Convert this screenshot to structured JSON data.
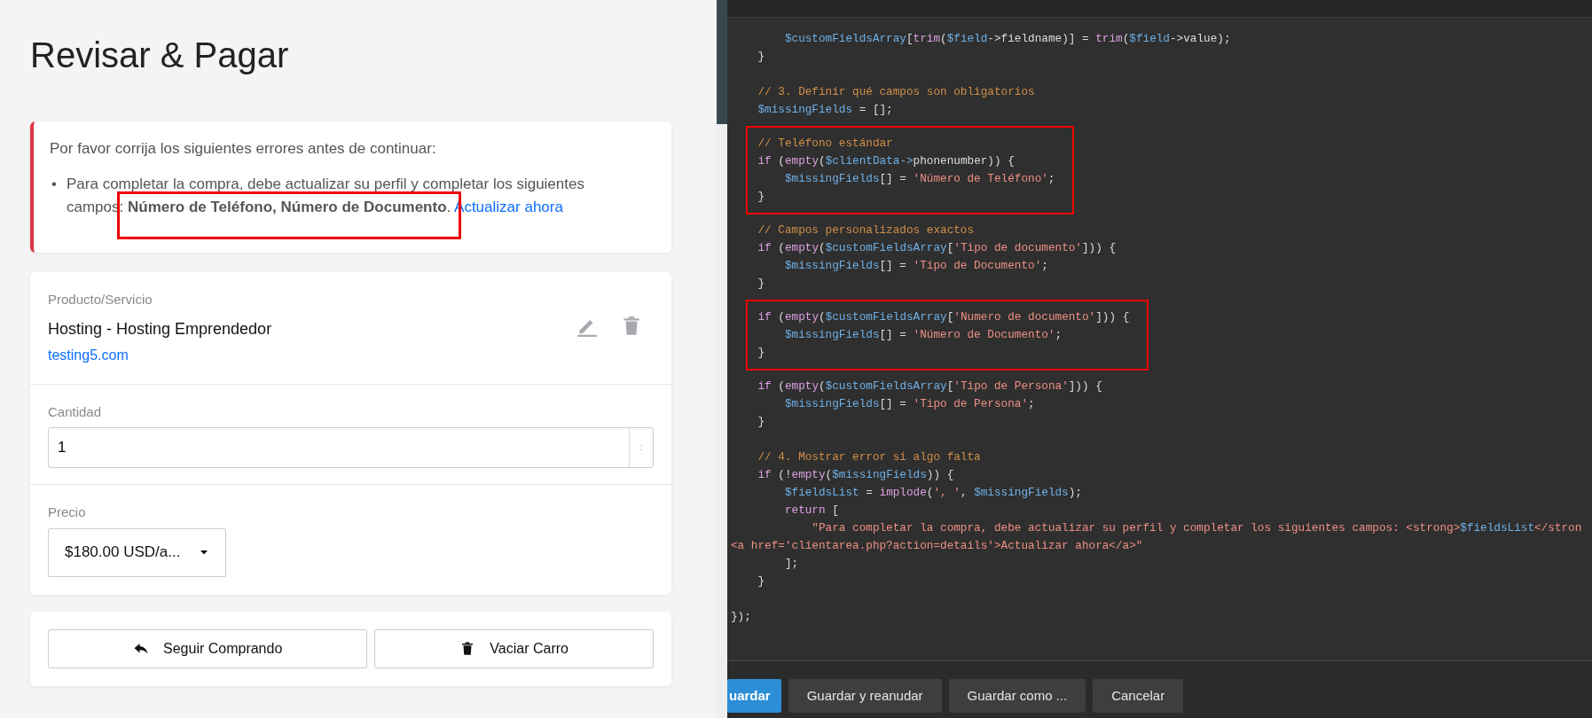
{
  "checkout": {
    "title": "Revisar & Pagar",
    "error_alert": {
      "intro": "Por favor corrija los siguientes errores antes de continuar:",
      "items": [
        {
          "bullet": "•",
          "text": "Para completar la compra, debe actualizar su perfil y completar los siguientes campos: **Número de Teléfono, Número de Documento**.",
          "link": "Actualizar ahora",
          "highlighted": true
        }
      ]
    },
    "product": {
      "label": "Producto/Servicio",
      "name": "Hosting - Hosting Emprendedor",
      "domain": "testing5.com"
    },
    "quantity": {
      "label": "Cantidad",
      "value": "1"
    },
    "price": {
      "label": "Precio",
      "value": "$180.00 USD/a..."
    },
    "actions": [
      {
        "label": "Seguir Comprando",
        "kind": "reply"
      },
      {
        "label": "Vaciar Carro",
        "kind": "trash"
      }
    ]
  },
  "editor": {
    "code_blocks": [
      {
        "highlighted": false,
        "lines": [
          {
            "kind": "code",
            "tokens": [
              {
                "kind": "var",
                "text": "        $customFieldsArray"
              },
              {
                "kind": "plain",
                "text": "["
              },
              {
                "kind": "func",
                "text": "trim"
              },
              {
                "kind": "plain",
                "text": "("
              },
              {
                "kind": "var",
                "text": "$field"
              },
              {
                "kind": "plain",
                "text": "->fieldname)] = "
              },
              {
                "kind": "func",
                "text": "trim"
              },
              {
                "kind": "plain",
                "text": "("
              },
              {
                "kind": "var",
                "text": "$field"
              },
              {
                "kind": "plain",
                "text": "->value);"
              }
            ]
          },
          {
            "kind": "code",
            "tokens": [
              {
                "kind": "plain",
                "text": "    }"
              }
            ]
          },
          {
            "kind": "blank"
          },
          {
            "kind": "code",
            "tokens": [
              {
                "kind": "comment",
                "text": "    // 3. Definir qué campos son obligatorios"
              }
            ]
          },
          {
            "kind": "code",
            "tokens": [
              {
                "kind": "var",
                "text": "    $missingFields"
              },
              {
                "kind": "plain",
                "text": " = [];"
              }
            ]
          }
        ]
      },
      {
        "highlighted": true,
        "lines": [
          {
            "kind": "code",
            "tokens": [
              {
                "kind": "comment",
                "text": "    // Teléfono estándar"
              }
            ]
          },
          {
            "kind": "code",
            "tokens": [
              {
                "kind": "func",
                "text": "    if"
              },
              {
                "kind": "plain",
                "text": " ("
              },
              {
                "kind": "func",
                "text": "empty"
              },
              {
                "kind": "plain",
                "text": "("
              },
              {
                "kind": "var",
                "text": "$clientData->"
              },
              {
                "kind": "plain",
                "text": "phonenumber)) {"
              }
            ]
          },
          {
            "kind": "code",
            "tokens": [
              {
                "kind": "var",
                "text": "        $missingFields"
              },
              {
                "kind": "plain",
                "text": "[] = "
              },
              {
                "kind": "string",
                "text": "'Número de Teléfono'"
              },
              {
                "kind": "plain",
                "text": ";"
              }
            ]
          },
          {
            "kind": "code",
            "tokens": [
              {
                "kind": "plain",
                "text": "    }"
              }
            ]
          }
        ]
      },
      {
        "highlighted": false,
        "lines": [
          {
            "kind": "code",
            "tokens": [
              {
                "kind": "comment",
                "text": "    // Campos personalizados exactos"
              }
            ]
          },
          {
            "kind": "code",
            "tokens": [
              {
                "kind": "func",
                "text": "    if"
              },
              {
                "kind": "plain",
                "text": " ("
              },
              {
                "kind": "func",
                "text": "empty"
              },
              {
                "kind": "plain",
                "text": "("
              },
              {
                "kind": "var",
                "text": "$customFieldsArray"
              },
              {
                "kind": "plain",
                "text": "["
              },
              {
                "kind": "string",
                "text": "'Tipo de documento'"
              },
              {
                "kind": "plain",
                "text": "])) {"
              }
            ]
          },
          {
            "kind": "code",
            "tokens": [
              {
                "kind": "var",
                "text": "        $missingFields"
              },
              {
                "kind": "plain",
                "text": "[] = "
              },
              {
                "kind": "string",
                "text": "'Tipo de Documento'"
              },
              {
                "kind": "plain",
                "text": ";"
              }
            ]
          },
          {
            "kind": "code",
            "tokens": [
              {
                "kind": "plain",
                "text": "    }"
              }
            ]
          }
        ]
      },
      {
        "highlighted": true,
        "lines": [
          {
            "kind": "code",
            "tokens": [
              {
                "kind": "func",
                "text": "    if"
              },
              {
                "kind": "plain",
                "text": " ("
              },
              {
                "kind": "func",
                "text": "empty"
              },
              {
                "kind": "plain",
                "text": "("
              },
              {
                "kind": "var",
                "text": "$customFieldsArray"
              },
              {
                "kind": "plain",
                "text": "["
              },
              {
                "kind": "string",
                "text": "'Numero de documento'"
              },
              {
                "kind": "plain",
                "text": "])) {"
              }
            ]
          },
          {
            "kind": "code",
            "tokens": [
              {
                "kind": "var",
                "text": "        $missingFields"
              },
              {
                "kind": "plain",
                "text": "[] = "
              },
              {
                "kind": "string",
                "text": "'Número de Documento'"
              },
              {
                "kind": "plain",
                "text": ";"
              }
            ]
          },
          {
            "kind": "code",
            "tokens": [
              {
                "kind": "plain",
                "text": "    }"
              }
            ]
          }
        ]
      },
      {
        "highlighted": false,
        "lines": [
          {
            "kind": "code",
            "tokens": [
              {
                "kind": "func",
                "text": "    if"
              },
              {
                "kind": "plain",
                "text": " ("
              },
              {
                "kind": "func",
                "text": "empty"
              },
              {
                "kind": "plain",
                "text": "("
              },
              {
                "kind": "var",
                "text": "$customFieldsArray"
              },
              {
                "kind": "plain",
                "text": "["
              },
              {
                "kind": "string",
                "text": "'Tipo de Persona'"
              },
              {
                "kind": "plain",
                "text": "])) {"
              }
            ]
          },
          {
            "kind": "code",
            "tokens": [
              {
                "kind": "var",
                "text": "        $missingFields"
              },
              {
                "kind": "plain",
                "text": "[] = "
              },
              {
                "kind": "string",
                "text": "'Tipo de Persona'"
              },
              {
                "kind": "plain",
                "text": ";"
              }
            ]
          },
          {
            "kind": "code",
            "tokens": [
              {
                "kind": "plain",
                "text": "    }"
              }
            ]
          },
          {
            "kind": "blank"
          },
          {
            "kind": "code",
            "tokens": [
              {
                "kind": "comment",
                "text": "    // 4. Mostrar error si algo falta"
              }
            ]
          },
          {
            "kind": "code",
            "tokens": [
              {
                "kind": "func",
                "text": "    if"
              },
              {
                "kind": "plain",
                "text": " (!"
              },
              {
                "kind": "func",
                "text": "empty"
              },
              {
                "kind": "plain",
                "text": "("
              },
              {
                "kind": "var",
                "text": "$missingFields"
              },
              {
                "kind": "plain",
                "text": ")) {"
              }
            ]
          },
          {
            "kind": "code",
            "tokens": [
              {
                "kind": "var",
                "text": "        $fieldsList"
              },
              {
                "kind": "plain",
                "text": " = "
              },
              {
                "kind": "func",
                "text": "implode"
              },
              {
                "kind": "plain",
                "text": "("
              },
              {
                "kind": "string",
                "text": "', '"
              },
              {
                "kind": "plain",
                "text": ", "
              },
              {
                "kind": "var",
                "text": "$missingFields"
              },
              {
                "kind": "plain",
                "text": ");"
              }
            ]
          },
          {
            "kind": "code",
            "tokens": [
              {
                "kind": "func",
                "text": "        return"
              },
              {
                "kind": "plain",
                "text": " ["
              }
            ]
          },
          {
            "kind": "code",
            "tokens": [
              {
                "kind": "string",
                "text": "            \"Para completar la compra, debe actualizar su perfil y completar los siguientes campos: <strong>"
              },
              {
                "kind": "var",
                "text": "$fieldsList"
              },
              {
                "kind": "string",
                "text": "</stron"
              }
            ]
          },
          {
            "kind": "code",
            "tokens": [
              {
                "kind": "string",
                "text": "<a href='clientarea.php?action=details'>Actualizar ahora</a>\""
              }
            ]
          },
          {
            "kind": "code",
            "tokens": [
              {
                "kind": "plain",
                "text": "        ];"
              }
            ]
          },
          {
            "kind": "code",
            "tokens": [
              {
                "kind": "plain",
                "text": "    }"
              }
            ]
          },
          {
            "kind": "blank"
          },
          {
            "kind": "code",
            "tokens": [
              {
                "kind": "plain",
                "text": "});"
              }
            ]
          }
        ]
      }
    ],
    "buttons": [
      {
        "label": "uardar",
        "primary": true
      },
      {
        "label": "Guardar y reanudar",
        "primary": false
      },
      {
        "label": "Guardar como ...",
        "primary": false
      },
      {
        "label": "Cancelar",
        "primary": false
      }
    ]
  }
}
